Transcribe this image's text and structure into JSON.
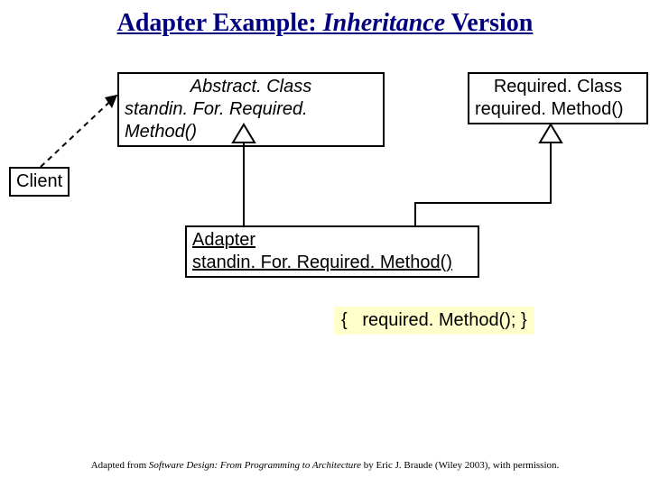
{
  "title": {
    "part1": "Adapter Example: ",
    "part2": "Inheritance",
    "part3": " Version"
  },
  "abstractClass": {
    "name": "Abstract. Class",
    "method": "standin. For. Required. Method()"
  },
  "requiredClass": {
    "name": "Required. Class",
    "method": "required. Method()"
  },
  "client": {
    "name": "Client"
  },
  "adapter": {
    "name": "Adapter",
    "method": "standin. For. Required. Method()"
  },
  "note": {
    "open": "{",
    "body": "required. Method(); }"
  },
  "citation": {
    "pre": "Adapted from ",
    "book": "Software Design: From Programming to Architecture",
    "post": " by Eric J. Braude (Wiley 2003), with permission."
  }
}
